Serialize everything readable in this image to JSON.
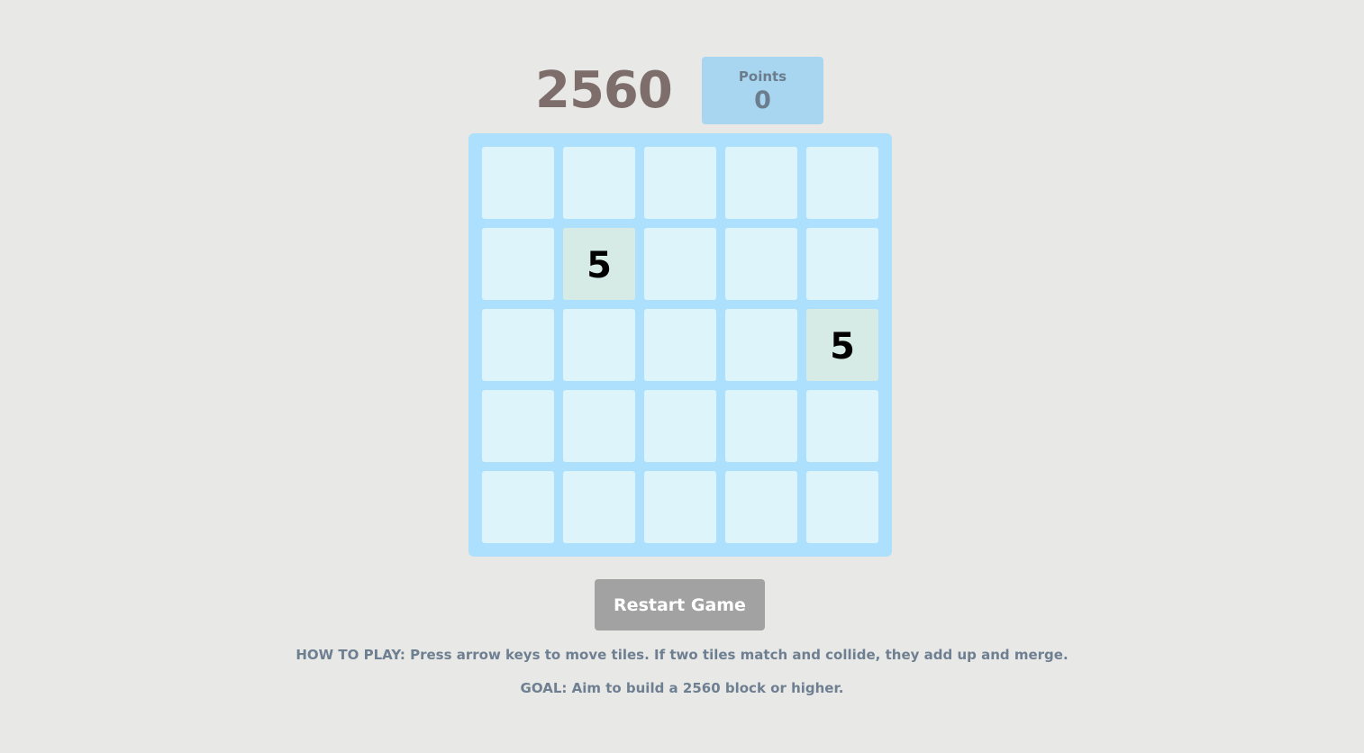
{
  "header": {
    "title": "2560",
    "score_label": "Points",
    "score_value": "0"
  },
  "board": {
    "size": 5,
    "tiles": [
      {
        "row": 1,
        "col": 1,
        "value": "5"
      },
      {
        "row": 2,
        "col": 4,
        "value": "5"
      }
    ]
  },
  "controls": {
    "restart_label": "Restart Game"
  },
  "instructions": {
    "how_to_play": "HOW TO PLAY: Press arrow keys to move tiles. If two tiles match and collide, they add up and merge.",
    "goal": "GOAL: Aim to build a 2560 block or higher."
  },
  "colors": {
    "background": "#e8e9e6",
    "board": "#ade0fc",
    "empty_cell": "#ddf5fa",
    "tile": "#d7ebe6",
    "score_box": "#a8d6f1",
    "button": "#a2a2a2"
  }
}
